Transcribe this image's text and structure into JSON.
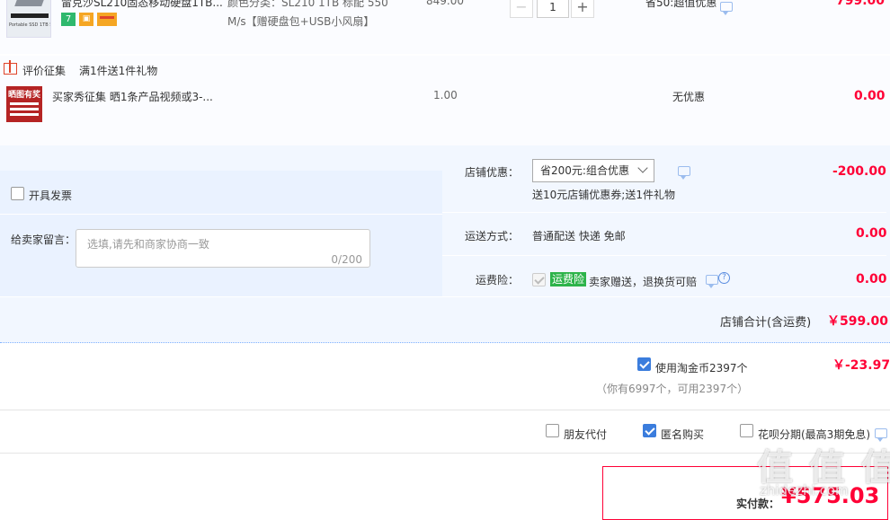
{
  "product": {
    "title": "雷克沙SL210固态移动硬盘1TB...",
    "spec_line1": "颜色分类：SL210 1TB 标配 550",
    "spec_line2": "M/s【赠硬盘包+USB小风扇】",
    "price": "849.00",
    "quantity": "1",
    "minus": "−",
    "plus": "+",
    "discount": "省50:超值优惠",
    "subtotal": "799.00",
    "thumb_label": "Portable SSD 1TB 550MB/s"
  },
  "gift": {
    "header_label": "评价征集",
    "header_desc": "满1件送1件礼物",
    "item_title": "买家秀征集 晒1条产品视频或3-...",
    "item_price": "1.00",
    "item_discount": "无优惠",
    "item_subtotal": "0.00",
    "thumb_text": "晒图有奖"
  },
  "shop": {
    "invoice_label": "开具发票",
    "coupon_label": "店铺优惠：",
    "coupon_select": "省200元:组合优惠",
    "coupon_desc": "送10元店铺优惠券;送1件礼物",
    "coupon_amount": "-200.00",
    "message_label": "给卖家留言：",
    "message_placeholder": "选填,请先和商家协商一致",
    "message_counter": "0/200",
    "shipping_label": "运送方式：",
    "shipping_value": "普通配送 快递 免邮",
    "shipping_amount": "0.00",
    "insurance_label": "运费险：",
    "insurance_badge": "运费险",
    "insurance_desc": "卖家赠送，退换货可赔",
    "insurance_amount": "0.00",
    "total_label": "店铺合计(含运费)",
    "total_amount": "￥599.00"
  },
  "coins": {
    "label": "使用淘金币2397个",
    "amount": "￥-23.97",
    "hint": "（你有6997个，可用2397个）"
  },
  "pay_options": {
    "friend_pay": "朋友代付",
    "anonymous": "匿名购买",
    "huabei": "花呗分期(最高3期免息)"
  },
  "final": {
    "label": "实付款：",
    "amount": "¥575.03"
  },
  "watermark": "值 值 值",
  "watermark_sub": "zhidezhi.com",
  "colors": {
    "accent_red": "#ff0036",
    "panel_bg": "#f2f7ff",
    "link_blue": "#3b7ddd",
    "badge_green": "#2db34a"
  }
}
